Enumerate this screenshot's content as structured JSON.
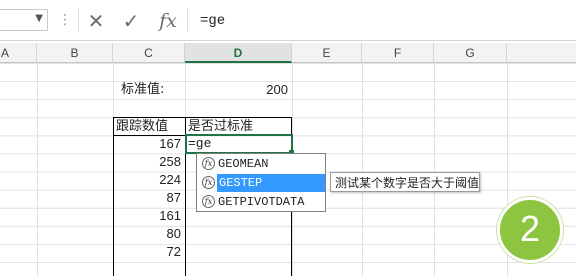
{
  "formula_bar": {
    "cancel_icon": "✕",
    "enter_icon": "✓",
    "fx_label": "fx",
    "content": "=ge"
  },
  "columns": [
    "A",
    "B",
    "C",
    "D",
    "E",
    "F",
    "G"
  ],
  "selected_column": "D",
  "cells": {
    "threshold_label": "标准值:",
    "threshold_value": "200",
    "header_tracking": "跟踪数值",
    "header_pass": "是否过标准",
    "values": [
      "167",
      "258",
      "224",
      "87",
      "161",
      "80",
      "72"
    ],
    "editing_value": "=ge"
  },
  "autocomplete": {
    "items": [
      "GEOMEAN",
      "GESTEP",
      "GETPIVOTDATA"
    ],
    "highlighted_index": 1,
    "tooltip": "测试某个数字是否大于阈值"
  },
  "badge": {
    "label": "2",
    "color": "#8dc540"
  },
  "colors": {
    "accent": "#217346",
    "highlight": "#3399ff",
    "active_cell_border": "#217346"
  }
}
